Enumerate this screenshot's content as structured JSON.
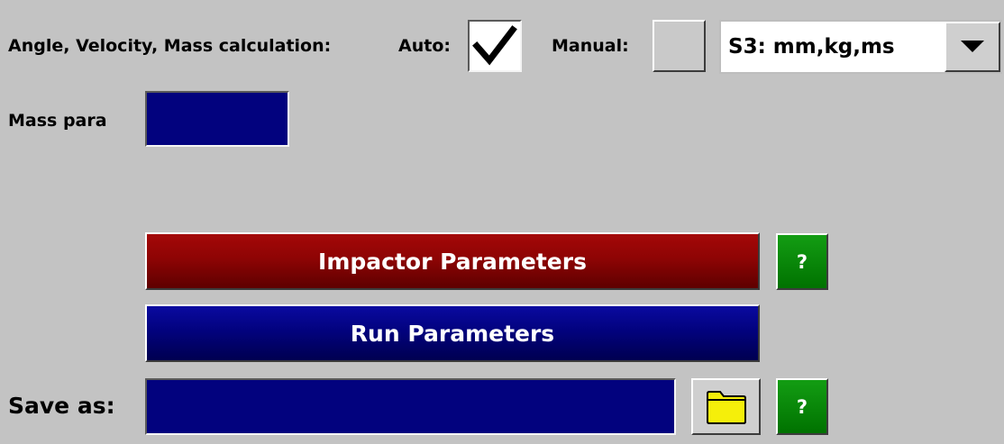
{
  "calc": {
    "label": "Angle, Velocity, Mass calculation:",
    "auto_label": "Auto:",
    "auto_checked": true,
    "manual_label": "Manual:",
    "manual_checked": false
  },
  "units": {
    "selected": "S3: mm,kg,ms"
  },
  "mass": {
    "label": "Mass para",
    "value": ""
  },
  "buttons": {
    "impactor": "Impactor Parameters",
    "run": "Run Parameters",
    "help": "?"
  },
  "save": {
    "label": "Save as:",
    "value": ""
  },
  "colors": {
    "background": "#c3c3c3",
    "field_blue": "#02027e",
    "impactor_red": "#8e0404",
    "help_green": "#0a8a0a",
    "folder_yellow": "#f5ef0a"
  },
  "icons": {
    "checkmark": "checkmark-icon",
    "dropdown": "dropdown-arrow-icon",
    "folder": "folder-icon"
  }
}
